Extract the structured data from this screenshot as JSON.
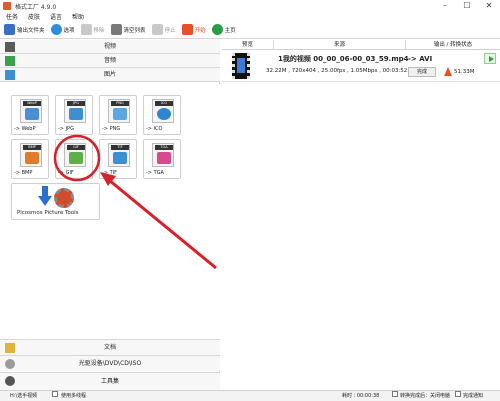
{
  "window": {
    "title": "格式工厂 4.9.0",
    "minimize": "–",
    "maximize": "☐",
    "close": "✕"
  },
  "menu": [
    "任务",
    "皮肤",
    "语言",
    "帮助"
  ],
  "toolbar": [
    {
      "label": "输出文件夹",
      "icon": "folder-icon",
      "enabled": true
    },
    {
      "label": "选项",
      "icon": "options-icon",
      "enabled": true
    },
    {
      "label": "移除",
      "icon": "remove-icon",
      "enabled": false
    },
    {
      "label": "清空列表",
      "icon": "clear-list-icon",
      "enabled": true
    },
    {
      "label": "停止",
      "icon": "stop-icon",
      "enabled": false
    },
    {
      "label": "开始",
      "icon": "start-icon",
      "enabled": true
    },
    {
      "label": "主页",
      "icon": "home-icon",
      "enabled": true
    }
  ],
  "categories": {
    "video": "视频",
    "audio": "音频",
    "picture": "图片",
    "document": "文档",
    "disc": "光驱设备\\DVD\\CD\\ISO",
    "tools": "工具集"
  },
  "picture_formats": [
    {
      "label": "-> WebP",
      "fmt": "WebP",
      "color": "#4a8fd6"
    },
    {
      "label": "-> JPG",
      "fmt": "JPG",
      "color": "#3f8fd0"
    },
    {
      "label": "-> PNG",
      "fmt": "PNG",
      "color": "#5aa7e6"
    },
    {
      "label": "-> ICO",
      "fmt": "ICO",
      "color": "#2e86d0"
    },
    {
      "label": "-> BMP",
      "fmt": "BMP",
      "color": "#e07b2a"
    },
    {
      "label": "-> GIF",
      "fmt": "GIF",
      "color": "#5fae4a"
    },
    {
      "label": "-> TIF",
      "fmt": "TIF",
      "color": "#3b8fd6"
    },
    {
      "label": "-> TGA",
      "fmt": "TGA",
      "color": "#d84a8e"
    }
  ],
  "picture_tools_label": "Picosmos Picture Tools",
  "task_table": {
    "headers": [
      "预览",
      "来源",
      "输出 / 转换状态"
    ],
    "rows": [
      {
        "filename": "1我的视频 00_00_06-00_03_59.mp4",
        "info": "32.22M , 720x404 , 25.00fps , 1.05Mbps , 00:03:52.00",
        "target": "-> AVI",
        "status": "完成",
        "output_size": "51.33M"
      }
    ]
  },
  "statusbar": {
    "path": "H:\\选手视频",
    "multithread": "使用多线程",
    "elapsed_label": "耗时 : 00:00:38",
    "after_convert": "转换完成后：关闭电脑",
    "notify": "完成通知"
  },
  "colors": {
    "annotation": "#d8202a"
  }
}
